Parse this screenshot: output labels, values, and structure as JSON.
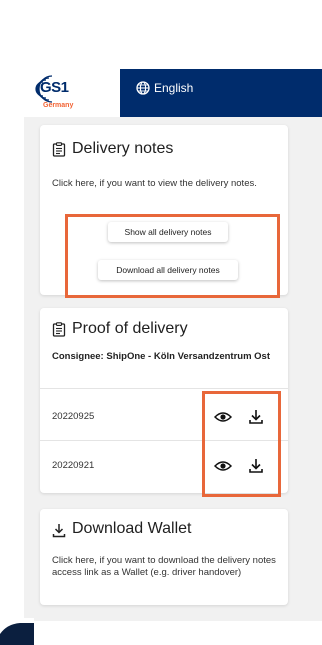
{
  "header": {
    "logo_text": "GS1",
    "logo_sub": "Germany",
    "language_label": "English"
  },
  "delivery_notes": {
    "title": "Delivery notes",
    "description": "Click here, if you want to view the delivery notes.",
    "show_all_label": "Show all delivery notes",
    "download_all_label": "Download all delivery notes"
  },
  "proof_of_delivery": {
    "title": "Proof of delivery",
    "consignee": "Consignee: ShipOne - Köln Versandzentrum Ost",
    "rows": [
      {
        "date": "20220925"
      },
      {
        "date": "20220921"
      }
    ]
  },
  "download_wallet": {
    "title": "Download Wallet",
    "description": "Click here, if you want to download the delivery notes access link as a Wallet (e.g. driver handover)"
  },
  "colors": {
    "brand_navy": "#002c6c",
    "brand_orange": "#f26334",
    "highlight_orange": "#e8673a",
    "screen_background": "#f1f1f1"
  },
  "icons": [
    "gs1-logo-icon",
    "globe-icon",
    "clipboard-icon",
    "eye-icon",
    "download-icon"
  ]
}
